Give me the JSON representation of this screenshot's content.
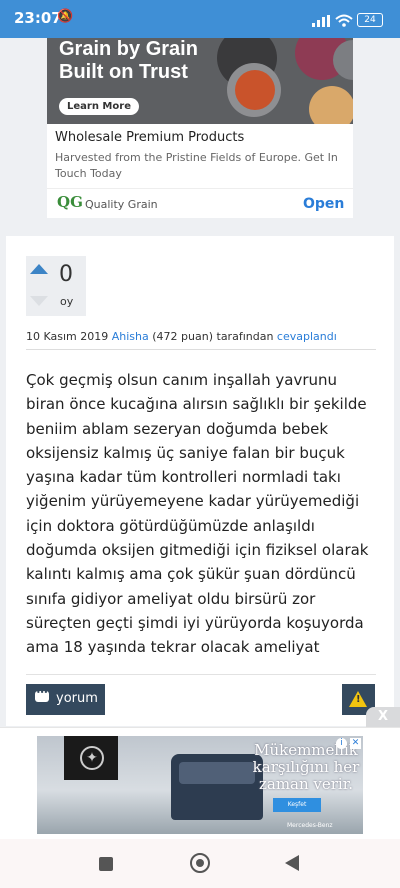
{
  "status_bar": {
    "time": "23:07",
    "battery": "24"
  },
  "ad_top": {
    "headline_line1": "Grain by Grain",
    "headline_line2": "Built on Trust",
    "learn_more": "Learn More",
    "title": "Wholesale Premium Products",
    "description": "Harvested from the Pristine Fields of Europe. Get In Touch Today",
    "logo": "QG",
    "brand": "Quality Grain",
    "open": "Open"
  },
  "answer": {
    "votes": "0",
    "vote_unit": "oy",
    "date": "10 Kasım 2019",
    "author": "Ahisha",
    "points": "(472 puan)",
    "by": "tarafından",
    "action": "cevaplandı",
    "body": "Çok geçmiş olsun canım inşallah yavrunu biran önce kucağına alırsın sağlıklı bir şekilde beniim ablam sezeryan doğumda bebek oksijensiz kalmış üç saniye falan bir buçuk yaşına kadar tüm kontrolleri normladi takı yiğenim yürüyemeyene kadar yürüyemediği için doktora götürdüğümüzde anlaşıldı doğumda oksijen gitmediği için fiziksel olarak kalıntı kalmış ama çok şükür şuan dördüncü sınıfa gidiyor ameliyat oldu birsürü zor süreçten geçti şimdi iyi yürüyorda koşuyorda ama 18 yaşında tekrar olacak ameliyat",
    "comment_label": "yorum"
  },
  "ad_bottom": {
    "close": "X",
    "slogan": "Mükemmellik karşılığını her zaman verir.",
    "cta": "Keşfet",
    "brand": "Mercedes-Benz"
  },
  "icons": [
    "upvote-icon",
    "downvote-icon",
    "comment-icon",
    "warning-icon",
    "mercedes-star-icon",
    "adchoices-icon",
    "nav-square-icon",
    "nav-home-icon",
    "nav-back-icon"
  ]
}
